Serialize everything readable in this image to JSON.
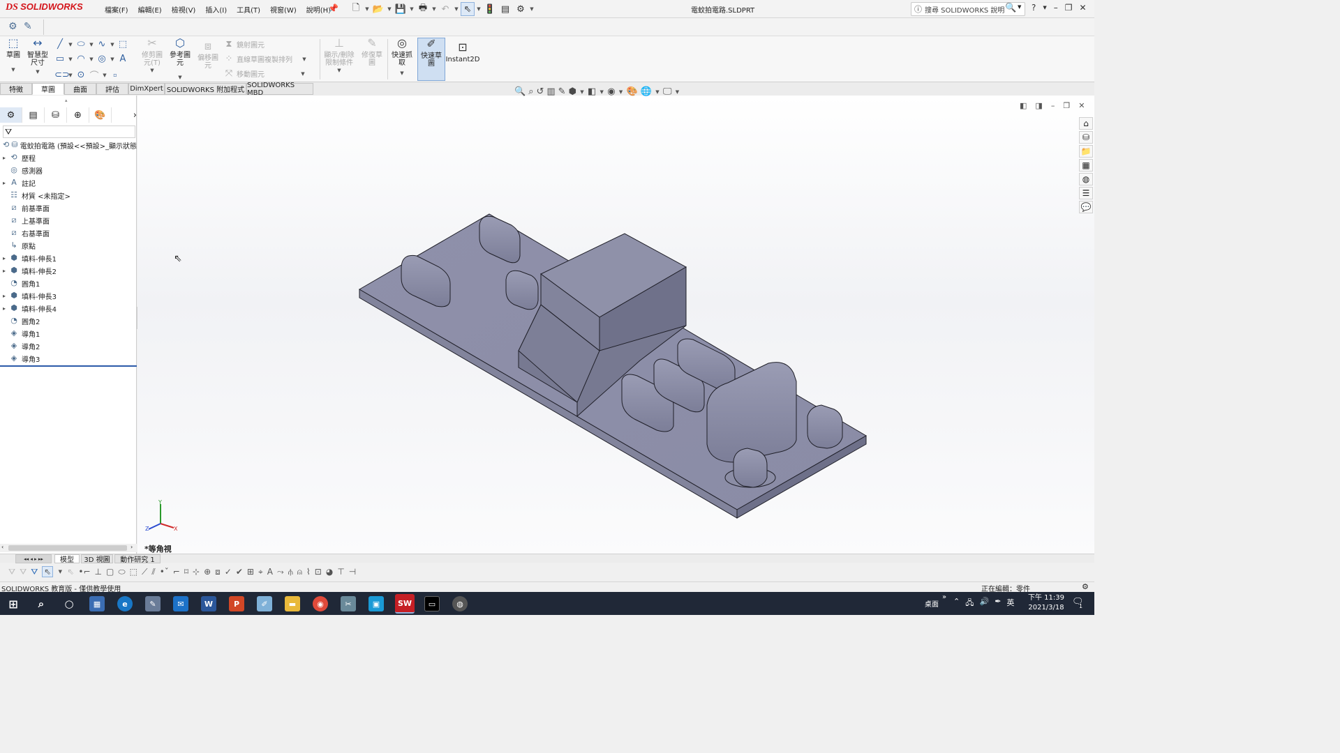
{
  "app": {
    "logo_ds": "DS",
    "logo_name": "SOLIDWORKS",
    "menu": [
      "檔案(F)",
      "編輯(E)",
      "檢視(V)",
      "插入(I)",
      "工具(T)",
      "視窗(W)",
      "說明(H)"
    ],
    "window_title": "電蚊拍電路.SLDPRT",
    "search_placeholder": "搜尋 SOLIDWORKS 說明",
    "help_label": "?",
    "colors": {
      "brand_red": "#d4151b",
      "part_color": "#8a8ca6",
      "taskbar": "#202837"
    }
  },
  "ribbon": {
    "sketch_label": "草圖",
    "smart_dim_label": "智慧型尺寸",
    "trim_label": "修剪圖元(T)",
    "ref_geom_label": "參考圖元",
    "offset_label": "偏移圖元",
    "mirror_label": "鏡射圖元",
    "linear_pattern_label": "直線草圖複製排列",
    "move_label": "移動圖元",
    "show_relations_label": "顯示/刪除限制條件",
    "repair_label": "修復草圖",
    "quick_snaps_label": "快速抓取",
    "rapid_sketch_label": "快速草圖",
    "instant2d_label": "Instant2D"
  },
  "tabs": [
    "特徵",
    "草圖",
    "曲面",
    "評估",
    "DimXpert",
    "SOLIDWORKS 附加程式",
    "SOLIDWORKS MBD"
  ],
  "active_tab": "草圖",
  "tree": {
    "root": "電蚊拍電路 (預設<<預設>_顯示狀態",
    "items": [
      {
        "label": "歷程",
        "icon": "history-icon",
        "expandable": true
      },
      {
        "label": "感測器",
        "icon": "sensor-icon",
        "expandable": false
      },
      {
        "label": "註記",
        "icon": "annotation-icon",
        "expandable": true
      },
      {
        "label": "材質 <未指定>",
        "icon": "material-icon",
        "expandable": false
      },
      {
        "label": "前基準面",
        "icon": "plane-icon",
        "expandable": false
      },
      {
        "label": "上基準面",
        "icon": "plane-icon",
        "expandable": false
      },
      {
        "label": "右基準面",
        "icon": "plane-icon",
        "expandable": false
      },
      {
        "label": "原點",
        "icon": "origin-icon",
        "expandable": false
      },
      {
        "label": "填料-伸長1",
        "icon": "extrude-icon",
        "expandable": true
      },
      {
        "label": "填料-伸長2",
        "icon": "extrude-icon",
        "expandable": true
      },
      {
        "label": "圓角1",
        "icon": "fillet-icon",
        "expandable": false
      },
      {
        "label": "填料-伸長3",
        "icon": "extrude-icon",
        "expandable": true
      },
      {
        "label": "填料-伸長4",
        "icon": "extrude-icon",
        "expandable": true
      },
      {
        "label": "圓角2",
        "icon": "fillet-icon",
        "expandable": false
      },
      {
        "label": "導角1",
        "icon": "chamfer-icon",
        "expandable": false
      },
      {
        "label": "導角2",
        "icon": "chamfer-icon",
        "expandable": false
      },
      {
        "label": "導角3",
        "icon": "chamfer-icon",
        "expandable": false
      }
    ]
  },
  "viewport": {
    "view_name": "*等角視",
    "triad": {
      "x": "X",
      "y": "Y",
      "z": "Z"
    }
  },
  "bottom_tabs": [
    "模型",
    "3D 視圖",
    "動作研究 1"
  ],
  "status": {
    "left": "SOLIDWORKS 教育版 - 僅供教學使用",
    "right": "正在編輯：零件"
  },
  "taskbar": {
    "desktop_label": "桌面",
    "ime_label": "英",
    "time": "下午 11:39",
    "date": "2021/3/18",
    "notification_count": "1"
  }
}
